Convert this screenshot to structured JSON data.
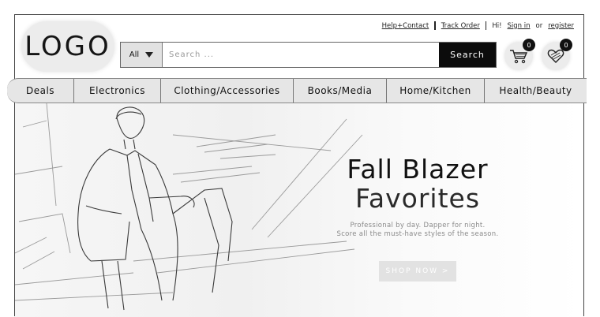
{
  "header": {
    "logo_text": "LOGO",
    "links": {
      "help": "Help+Contact",
      "track": "Track Order",
      "greeting": "Hi!",
      "sign_in": "Sign in",
      "or": "or",
      "register": "register"
    }
  },
  "search": {
    "category": "All",
    "placeholder": "Search ...",
    "button_label": "Search"
  },
  "cart": {
    "icon": "cart-icon",
    "count": "0"
  },
  "wishlist": {
    "icon": "heart-icon",
    "count": "0"
  },
  "nav": {
    "items": [
      {
        "label": "Deals"
      },
      {
        "label": "Electronics"
      },
      {
        "label": "Clothing/Accessories"
      },
      {
        "label": "Books/Media"
      },
      {
        "label": "Home/Kitchen"
      },
      {
        "label": "Health/Beauty"
      }
    ]
  },
  "hero": {
    "title_line1": "Fall Blazer",
    "title_line2": "Favorites",
    "subtitle_line1": "Professional by day. Dapper for night.",
    "subtitle_line2": "Score all the must-have styles of the season.",
    "cta_label": "SHOP NOW >"
  },
  "colors": {
    "nav_bg": "#e6e6e6",
    "search_button_bg": "#0c0c0c",
    "cta_bg": "#e2e2e2"
  }
}
